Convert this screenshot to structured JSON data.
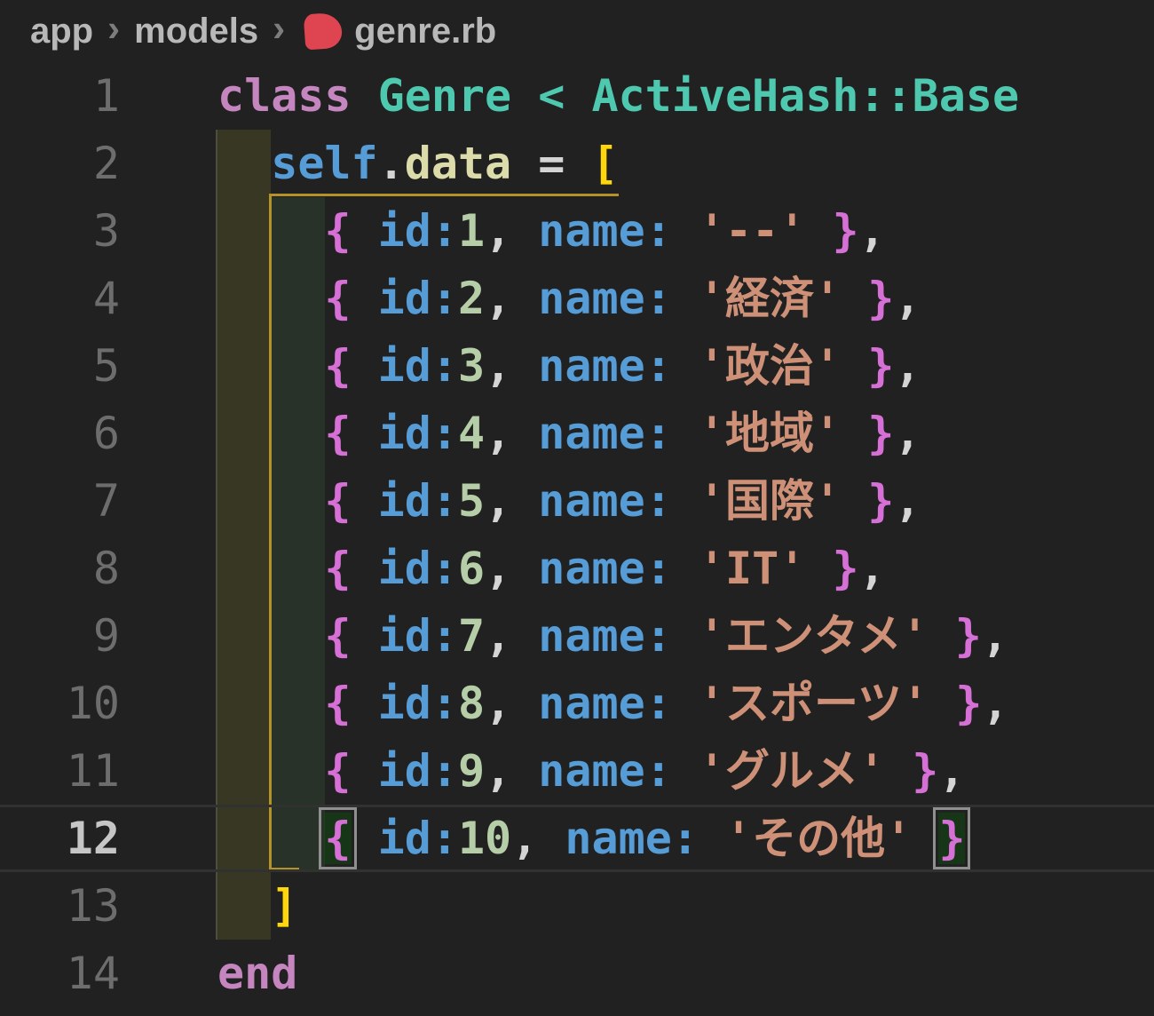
{
  "breadcrumb": {
    "segments": [
      "app",
      "models"
    ],
    "separator": "›",
    "file_icon": "ruby-icon",
    "file": "genre.rb"
  },
  "editor": {
    "language": "ruby",
    "colors": {
      "background": "#212121",
      "keyword": "#C586C0",
      "class_name": "#4EC9B0",
      "self_keyword": "#569CD6",
      "method": "#DCDCAA",
      "symbol_key": "#569CD6",
      "number": "#B5CEA8",
      "string": "#CE9178",
      "punctuation": "#D4D4D4",
      "square_bracket": "#FFD60A",
      "curly_brace": "#D670D6",
      "bracket_guide": "#B3922A",
      "indent_level1_bg": "rgba(255,255,64,0.10)",
      "indent_level2_bg": "rgba(130,255,130,0.08)",
      "line_number": "#6D6D6D",
      "active_line_number": "#C6C6C6",
      "ruby_icon": "#DE4550"
    },
    "lines": [
      {
        "num": "1",
        "active": false,
        "tokens": [
          [
            "kw",
            "class "
          ],
          [
            "type",
            "Genre < ActiveHash::Base"
          ]
        ]
      },
      {
        "num": "2",
        "active": false,
        "tokens": [
          [
            "plain",
            "  "
          ],
          [
            "self",
            "self"
          ],
          [
            "plain",
            "."
          ],
          [
            "method",
            "data"
          ],
          [
            "plain",
            " = "
          ],
          [
            "bracket1",
            "["
          ]
        ]
      },
      {
        "num": "3",
        "active": false,
        "tokens": [
          [
            "plain",
            "    "
          ],
          [
            "brace",
            "{"
          ],
          [
            "plain",
            " "
          ],
          [
            "key",
            "id:"
          ],
          [
            "num",
            "1"
          ],
          [
            "plain",
            ", "
          ],
          [
            "key",
            "name:"
          ],
          [
            "plain",
            " "
          ],
          [
            "str",
            "'--'"
          ],
          [
            "plain",
            " "
          ],
          [
            "brace",
            "}"
          ],
          [
            "plain",
            ","
          ]
        ]
      },
      {
        "num": "4",
        "active": false,
        "tokens": [
          [
            "plain",
            "    "
          ],
          [
            "brace",
            "{"
          ],
          [
            "plain",
            " "
          ],
          [
            "key",
            "id:"
          ],
          [
            "num",
            "2"
          ],
          [
            "plain",
            ", "
          ],
          [
            "key",
            "name:"
          ],
          [
            "plain",
            " "
          ],
          [
            "str",
            "'経済'"
          ],
          [
            "plain",
            " "
          ],
          [
            "brace",
            "}"
          ],
          [
            "plain",
            ","
          ]
        ]
      },
      {
        "num": "5",
        "active": false,
        "tokens": [
          [
            "plain",
            "    "
          ],
          [
            "brace",
            "{"
          ],
          [
            "plain",
            " "
          ],
          [
            "key",
            "id:"
          ],
          [
            "num",
            "3"
          ],
          [
            "plain",
            ", "
          ],
          [
            "key",
            "name:"
          ],
          [
            "plain",
            " "
          ],
          [
            "str",
            "'政治'"
          ],
          [
            "plain",
            " "
          ],
          [
            "brace",
            "}"
          ],
          [
            "plain",
            ","
          ]
        ]
      },
      {
        "num": "6",
        "active": false,
        "tokens": [
          [
            "plain",
            "    "
          ],
          [
            "brace",
            "{"
          ],
          [
            "plain",
            " "
          ],
          [
            "key",
            "id:"
          ],
          [
            "num",
            "4"
          ],
          [
            "plain",
            ", "
          ],
          [
            "key",
            "name:"
          ],
          [
            "plain",
            " "
          ],
          [
            "str",
            "'地域'"
          ],
          [
            "plain",
            " "
          ],
          [
            "brace",
            "}"
          ],
          [
            "plain",
            ","
          ]
        ]
      },
      {
        "num": "7",
        "active": false,
        "tokens": [
          [
            "plain",
            "    "
          ],
          [
            "brace",
            "{"
          ],
          [
            "plain",
            " "
          ],
          [
            "key",
            "id:"
          ],
          [
            "num",
            "5"
          ],
          [
            "plain",
            ", "
          ],
          [
            "key",
            "name:"
          ],
          [
            "plain",
            " "
          ],
          [
            "str",
            "'国際'"
          ],
          [
            "plain",
            " "
          ],
          [
            "brace",
            "}"
          ],
          [
            "plain",
            ","
          ]
        ]
      },
      {
        "num": "8",
        "active": false,
        "tokens": [
          [
            "plain",
            "    "
          ],
          [
            "brace",
            "{"
          ],
          [
            "plain",
            " "
          ],
          [
            "key",
            "id:"
          ],
          [
            "num",
            "6"
          ],
          [
            "plain",
            ", "
          ],
          [
            "key",
            "name:"
          ],
          [
            "plain",
            " "
          ],
          [
            "str",
            "'IT'"
          ],
          [
            "plain",
            " "
          ],
          [
            "brace",
            "}"
          ],
          [
            "plain",
            ","
          ]
        ]
      },
      {
        "num": "9",
        "active": false,
        "tokens": [
          [
            "plain",
            "    "
          ],
          [
            "brace",
            "{"
          ],
          [
            "plain",
            " "
          ],
          [
            "key",
            "id:"
          ],
          [
            "num",
            "7"
          ],
          [
            "plain",
            ", "
          ],
          [
            "key",
            "name:"
          ],
          [
            "plain",
            " "
          ],
          [
            "str",
            "'エンタメ'"
          ],
          [
            "plain",
            " "
          ],
          [
            "brace",
            "}"
          ],
          [
            "plain",
            ","
          ]
        ]
      },
      {
        "num": "10",
        "active": false,
        "tokens": [
          [
            "plain",
            "    "
          ],
          [
            "brace",
            "{"
          ],
          [
            "plain",
            " "
          ],
          [
            "key",
            "id:"
          ],
          [
            "num",
            "8"
          ],
          [
            "plain",
            ", "
          ],
          [
            "key",
            "name:"
          ],
          [
            "plain",
            " "
          ],
          [
            "str",
            "'スポーツ'"
          ],
          [
            "plain",
            " "
          ],
          [
            "brace",
            "}"
          ],
          [
            "plain",
            ","
          ]
        ]
      },
      {
        "num": "11",
        "active": false,
        "tokens": [
          [
            "plain",
            "    "
          ],
          [
            "brace",
            "{"
          ],
          [
            "plain",
            " "
          ],
          [
            "key",
            "id:"
          ],
          [
            "num",
            "9"
          ],
          [
            "plain",
            ", "
          ],
          [
            "key",
            "name:"
          ],
          [
            "plain",
            " "
          ],
          [
            "str",
            "'グルメ'"
          ],
          [
            "plain",
            " "
          ],
          [
            "brace",
            "}"
          ],
          [
            "plain",
            ","
          ]
        ]
      },
      {
        "num": "12",
        "active": true,
        "tokens": [
          [
            "plain",
            "    "
          ],
          [
            "brace-match",
            "{"
          ],
          [
            "plain",
            " "
          ],
          [
            "key",
            "id:"
          ],
          [
            "num",
            "10"
          ],
          [
            "plain",
            ", "
          ],
          [
            "key",
            "name:"
          ],
          [
            "plain",
            " "
          ],
          [
            "str",
            "'その他'"
          ],
          [
            "plain",
            " "
          ],
          [
            "brace-match",
            "}"
          ]
        ]
      },
      {
        "num": "13",
        "active": false,
        "tokens": [
          [
            "plain",
            "  "
          ],
          [
            "bracket1",
            "]"
          ]
        ]
      },
      {
        "num": "14",
        "active": false,
        "tokens": [
          [
            "kw",
            "end"
          ]
        ]
      }
    ]
  }
}
